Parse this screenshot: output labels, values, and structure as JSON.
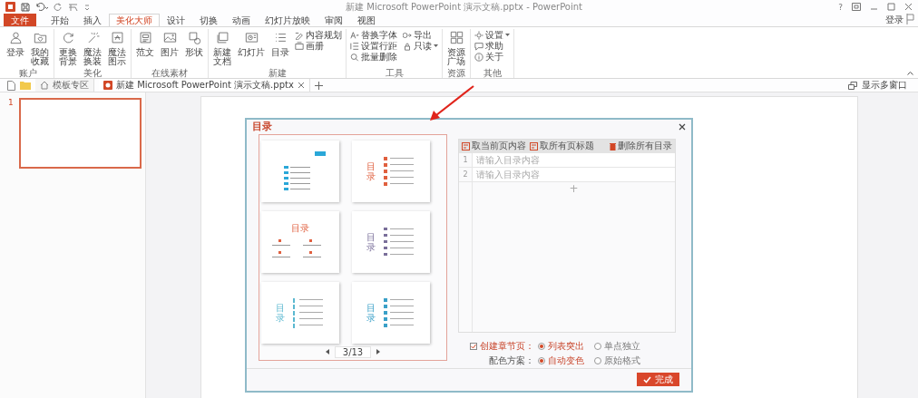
{
  "title_bar": {
    "title": "新建 Microsoft PowerPoint 演示文稿.pptx - PowerPoint",
    "help": "?"
  },
  "ribbon_tabs": [
    {
      "label": "文件",
      "kind": "file",
      "selected": false
    },
    {
      "label": "开始",
      "kind": "tab",
      "selected": false
    },
    {
      "label": "插入",
      "kind": "tab",
      "selected": false
    },
    {
      "label": "美化大师",
      "kind": "tab",
      "selected": true
    },
    {
      "label": "设计",
      "kind": "tab",
      "selected": false
    },
    {
      "label": "切换",
      "kind": "tab",
      "selected": false
    },
    {
      "label": "动画",
      "kind": "tab",
      "selected": false
    },
    {
      "label": "幻灯片放映",
      "kind": "tab",
      "selected": false
    },
    {
      "label": "审阅",
      "kind": "tab",
      "selected": false
    },
    {
      "label": "视图",
      "kind": "tab",
      "selected": false
    }
  ],
  "login": "登录",
  "ribbon_groups": [
    {
      "name": "账户",
      "large": [
        {
          "lines": [
            "登录"
          ]
        },
        {
          "lines": [
            "我的",
            "收藏"
          ]
        }
      ]
    },
    {
      "name": "美化",
      "large": [
        {
          "lines": [
            "更换",
            "背景"
          ]
        },
        {
          "lines": [
            "魔法",
            "换装"
          ]
        },
        {
          "lines": [
            "魔法",
            "图示"
          ]
        }
      ]
    },
    {
      "name": "在线素材",
      "large": [
        {
          "lines": [
            "范文"
          ]
        },
        {
          "lines": [
            "图片"
          ]
        },
        {
          "lines": [
            "形状"
          ]
        }
      ]
    },
    {
      "name": "新建",
      "large": [
        {
          "lines": [
            "新建",
            "文档"
          ]
        },
        {
          "lines": [
            "幻灯片"
          ]
        },
        {
          "lines": [
            "目录"
          ]
        }
      ],
      "small": [
        {
          "label": "内容规划",
          "caret": false
        },
        {
          "label": "画册",
          "caret": false
        }
      ]
    },
    {
      "name": "工具",
      "small": [
        {
          "label": "替换字体",
          "caret": false
        },
        {
          "label": "设置行距",
          "caret": false
        },
        {
          "label": "批量删除",
          "caret": false
        },
        {
          "label": "导出",
          "caret": false
        },
        {
          "label": "只读",
          "caret": true
        }
      ]
    },
    {
      "name": "资源",
      "large": [
        {
          "lines": [
            "资源",
            "广场"
          ]
        }
      ]
    },
    {
      "name": "其他",
      "small": [
        {
          "label": "设置",
          "caret": true
        },
        {
          "label": "求助",
          "caret": false
        },
        {
          "label": "关于",
          "caret": false
        }
      ]
    }
  ],
  "doc_tabs": [
    {
      "label": "模板专区",
      "kind": "home",
      "selected": false
    },
    {
      "label": "新建 Microsoft PowerPoint 演示文稿.pptx",
      "kind": "doc",
      "selected": true
    }
  ],
  "show_windows": "显示多窗口",
  "slides": [
    {
      "number": "1",
      "selected": true
    }
  ],
  "dialog": {
    "title": "目录",
    "templates": [
      {
        "kind": "badge",
        "color": "#2aa7d8"
      },
      {
        "kind": "side-dots",
        "title": "目录",
        "color": "#e0603f"
      },
      {
        "kind": "grid",
        "title": "目录",
        "color": "#e0603f"
      },
      {
        "kind": "side-flags",
        "title": "目录",
        "color": "#7a6f9a"
      },
      {
        "kind": "side-bars",
        "title": "目录",
        "color": "#5bb8d0"
      },
      {
        "kind": "side-dots",
        "title": "目录",
        "color": "#3aa0c8"
      }
    ],
    "pager": "3/13",
    "toolbar": [
      "取当前页内容",
      "取所有页标题",
      "删除所有目录"
    ],
    "entries": [
      {
        "number": "1",
        "placeholder": "请输入目录内容"
      },
      {
        "number": "2",
        "placeholder": "请输入目录内容"
      }
    ],
    "add": "+",
    "options": [
      {
        "label": "创建章节页：",
        "checked": true,
        "radios": [
          {
            "label": "列表突出",
            "selected": true
          },
          {
            "label": "单点独立",
            "selected": false
          }
        ]
      },
      {
        "label": "配色方案：",
        "radios": [
          {
            "label": "自动变色",
            "selected": true
          },
          {
            "label": "原始格式",
            "selected": false
          }
        ]
      }
    ],
    "done": "完成"
  }
}
